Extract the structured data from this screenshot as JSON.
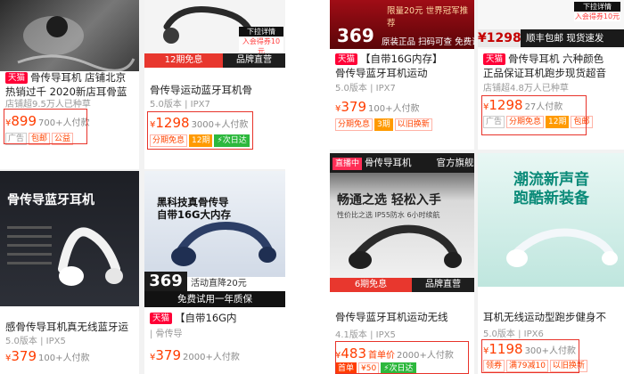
{
  "left": {
    "c1": {
      "platform": "天猫",
      "title1": "骨传导耳机 店铺北京",
      "title2": "热销过千 2020新店耳骨蓝",
      "title3": "店铺超9.5万人已种草",
      "price_symbol": "¥",
      "price": "899",
      "sold": "700+人付款",
      "tags": [
        "广告",
        "包邮",
        "公益"
      ]
    },
    "c2": {
      "banner_left": "12期免息",
      "banner_right": "品牌直营",
      "badge_line1": "下拉详情",
      "badge_line2": "入会得券10元",
      "title1": "骨传导运动蓝牙耳机骨",
      "title2": "5.0版本 | IPX7",
      "price_symbol": "¥",
      "price": "1298",
      "sold": "3000+人付款",
      "tags": [
        "分期免息",
        "12期",
        "⚡次日达"
      ]
    },
    "c3": {
      "product_name": "骨传导蓝牙耳机",
      "title1": "感骨传导耳机真无线蓝牙运",
      "title2": "5.0版本 | IPX5",
      "price_symbol": "¥",
      "price": "379",
      "sold": "100+人付款"
    },
    "c4": {
      "img_title1": "黑科技真骨传导",
      "img_title2": "自带16G大内存",
      "promo_big": "369",
      "promo1": "活动直降20元",
      "promo2": "免费试用一年质保",
      "platform": "天猫",
      "title1": "【自带16G内",
      "title2": "| 骨传导",
      "price_symbol": "¥",
      "price": "379",
      "sold": "2000+人付款"
    }
  },
  "right": {
    "c1": {
      "price_big": "369",
      "top_text": "限量20元 世界冠军推荐",
      "b1": "原装正品",
      "b2": "扫码可查",
      "b3": "免费试用",
      "platform": "天猫",
      "title1": "【自带16G内存】",
      "title2": "骨传导蓝牙耳机运动",
      "title3": "5.0版本 | IPX7",
      "price_symbol": "¥",
      "price": "379",
      "sold": "100+人付款",
      "tags": [
        "分期免息",
        "3期",
        "以旧换新"
      ]
    },
    "c2": {
      "badge_line1": "下拉详情",
      "badge_line2": "入会得券10元",
      "price_big": "¥1298",
      "b1": "顺丰包邮",
      "b2": "现货速发",
      "platform": "天猫",
      "title1": "骨传导耳机 六种颜色",
      "title2": "正品保证耳机跑步现货超音",
      "title3": "店铺超4.8万人已种草",
      "price_symbol": "¥",
      "price": "1298",
      "sold": "27人付款",
      "tags": [
        "广告",
        "分期免息",
        "12期",
        "包邮"
      ]
    },
    "c3": {
      "live": "直播中",
      "header1": "骨传导耳机",
      "header2": "官方旗舰店",
      "img_title": "畅通之选 轻松入手",
      "f1": "性价比之选",
      "f2": "IP55防水",
      "f3": "6小时续航",
      "banner_left": "6期免息",
      "banner_right": "品牌直营",
      "title1": "骨传导蓝牙耳机运动无线",
      "title2": "4.1版本 | IPX5",
      "price_symbol": "¥",
      "price": "483",
      "price_note": "首单价",
      "sold": "2000+人付款",
      "tags": [
        "首单",
        "¥50",
        "⚡次日达"
      ]
    },
    "c4": {
      "img_title1": "潮流新声音",
      "img_title2": "跑酷新装备",
      "title1": "耳机无线运动型跑步健身不",
      "title2": "5.0版本 | IPX6",
      "price_symbol": "¥",
      "price": "1198",
      "sold": "300+人付款",
      "tags": [
        "领券",
        "满79减10",
        "以旧换新"
      ]
    }
  }
}
